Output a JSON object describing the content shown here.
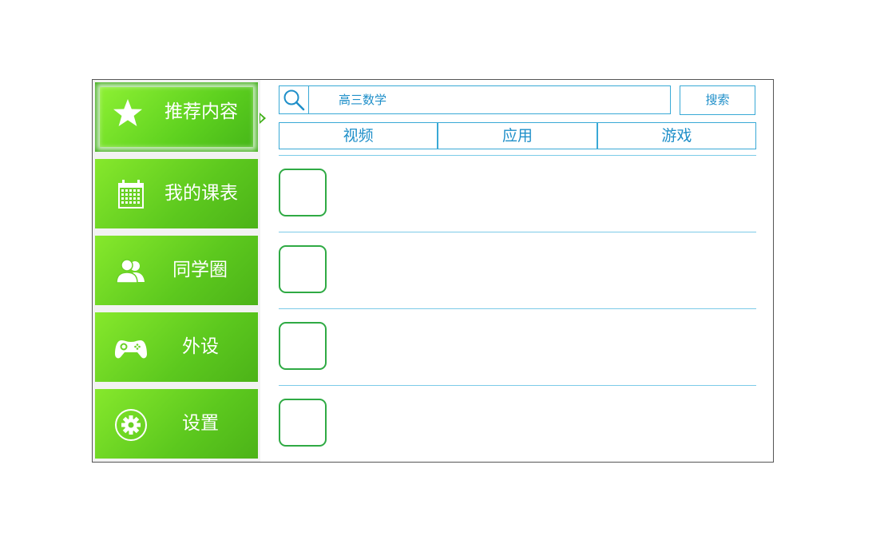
{
  "sidebar": {
    "items": [
      {
        "label": "推荐内容",
        "icon": "star-icon",
        "active": true
      },
      {
        "label": "我的课表",
        "icon": "calendar-icon",
        "active": false
      },
      {
        "label": "同学圈",
        "icon": "users-icon",
        "active": false
      },
      {
        "label": "外设",
        "icon": "gamepad-icon",
        "active": false
      },
      {
        "label": "设置",
        "icon": "gear-icon",
        "active": false
      }
    ]
  },
  "search": {
    "icon": "search-icon",
    "query": "高三数学",
    "button_label": "搜索"
  },
  "tabs": [
    {
      "label": "视频"
    },
    {
      "label": "应用"
    },
    {
      "label": "游戏"
    }
  ],
  "list": {
    "item_count": 4
  },
  "colors": {
    "accent_green": "#5cc81e",
    "accent_blue": "#1f8fc9",
    "thumb_border": "#2faa44"
  }
}
